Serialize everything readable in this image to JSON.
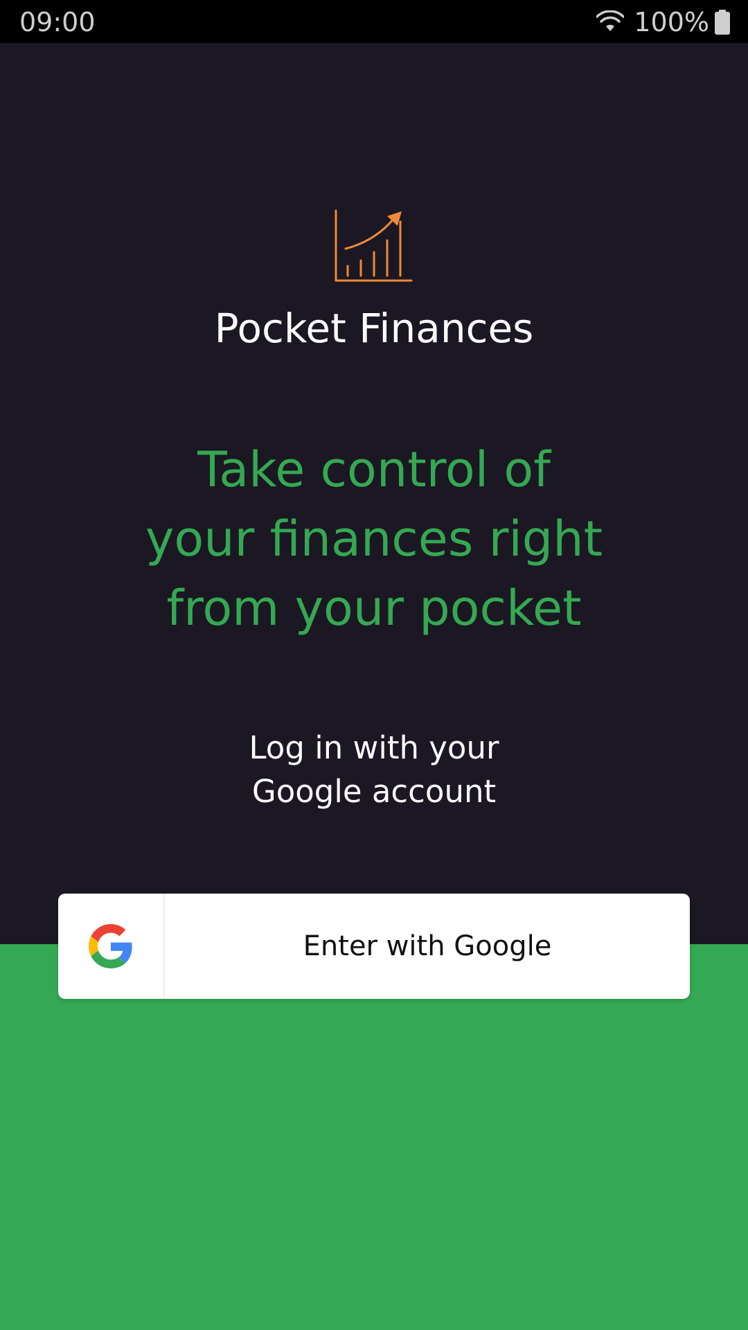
{
  "status_bar": {
    "time": "09:00",
    "battery_text": "100%",
    "icons": [
      "wifi-icon",
      "battery-icon"
    ]
  },
  "app": {
    "title": "Pocket Finances",
    "logo_icon": "growth-chart-icon"
  },
  "tagline": {
    "lines": [
      "Take control of",
      "your finances right",
      "from your pocket"
    ]
  },
  "login_hint": {
    "lines": [
      "Log in with your",
      "Google account"
    ]
  },
  "google_button": {
    "label": "Enter with Google",
    "icon": "google-icon"
  },
  "colors": {
    "background": "#1b1823",
    "accent_green": "#35a853",
    "logo_orange": "#f0883a",
    "status_bar": "#000000"
  }
}
